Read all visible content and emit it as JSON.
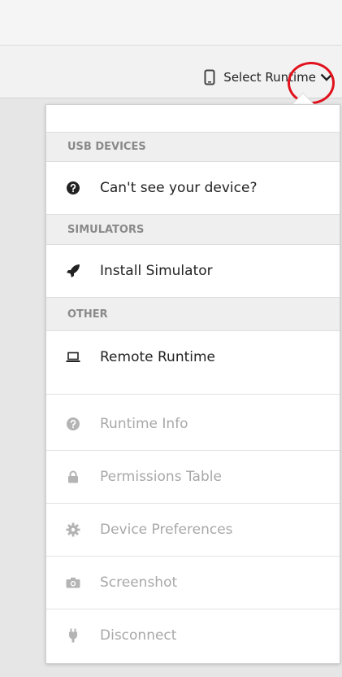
{
  "toolbar": {
    "runtime_label": "Select Runtime",
    "runtime_icon": "phone-icon",
    "chevron_icon": "chevron-down-icon"
  },
  "menu": {
    "usb_section": "USB DEVICES",
    "usb_items": [
      {
        "label": "Can't see your device?",
        "icon": "question-circle-icon",
        "enabled": true
      }
    ],
    "simulators_section": "SIMULATORS",
    "simulator_items": [
      {
        "label": "Install Simulator",
        "icon": "rocket-icon",
        "enabled": true
      }
    ],
    "other_section": "OTHER",
    "other_items": [
      {
        "label": "Remote Runtime",
        "icon": "laptop-icon",
        "enabled": true
      }
    ],
    "actions": [
      {
        "label": "Runtime Info",
        "icon": "question-circle-icon",
        "enabled": false
      },
      {
        "label": "Permissions Table",
        "icon": "lock-icon",
        "enabled": false
      },
      {
        "label": "Device Preferences",
        "icon": "gear-icon",
        "enabled": false
      },
      {
        "label": "Screenshot",
        "icon": "camera-icon",
        "enabled": false
      },
      {
        "label": "Disconnect",
        "icon": "plug-icon",
        "enabled": false
      }
    ]
  },
  "colors": {
    "highlight": "#e0121d",
    "enabled_text": "#222222",
    "disabled_text": "#a8a8a8",
    "section_text": "#8a8a8a"
  }
}
